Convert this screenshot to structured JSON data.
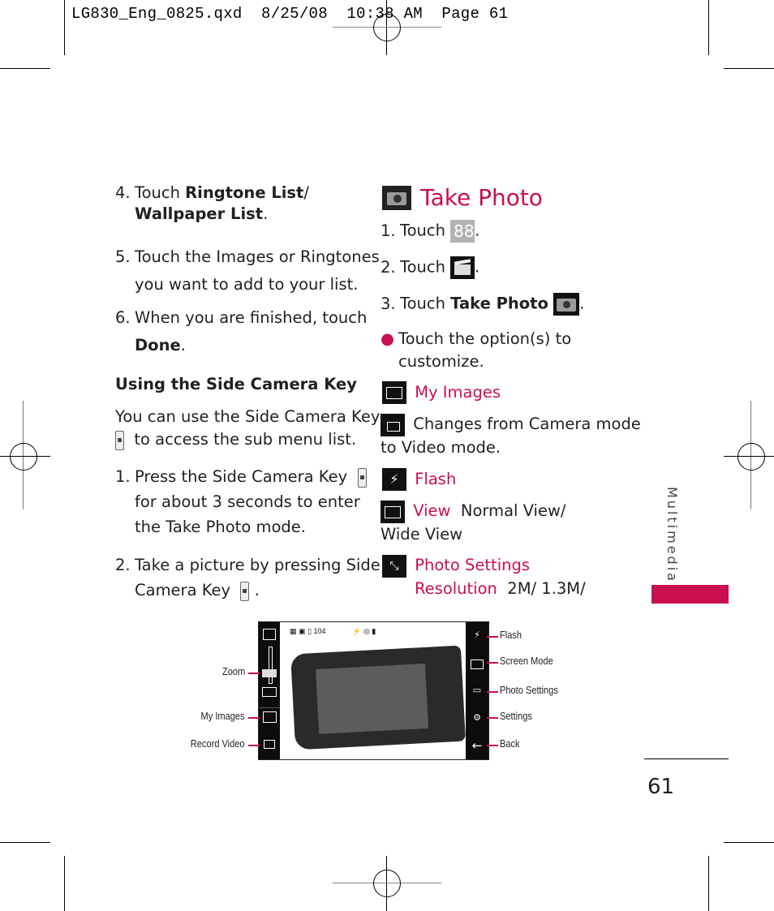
{
  "slug": "LG830_Eng_0825.qxd  8/25/08  10:38 AM  Page 61",
  "left_column": {
    "step4": {
      "num": "4.",
      "pre": "Touch ",
      "bold1": "Ringtone List",
      "mid": "/",
      "bold2": "Wallpaper List",
      "post": "."
    },
    "step5": {
      "num": "5.",
      "line1": "Touch the Images or Ringtones",
      "line2": "you want to add to your list."
    },
    "step6": {
      "num": "6.",
      "line1": "When you are finished, touch",
      "bold": "Done",
      "post": "."
    },
    "subheading": "Using the Side Camera Key",
    "intro_line1": "You can use the Side Camera Key",
    "intro_line2": "to access the sub menu list.",
    "side_step1": {
      "num": "1.",
      "line1": "Press the Side Camera Key",
      "line2": "for about 3 seconds to enter",
      "line3": "the Take Photo mode."
    },
    "side_step2": {
      "num": "2.",
      "line1": "Take a picture by pressing Side",
      "line2": "Camera Key",
      "post": "."
    }
  },
  "right_column": {
    "heading": "Take Photo",
    "step1": {
      "num": "1.",
      "text": "Touch",
      "icon": "grid-icon"
    },
    "step2": {
      "num": "2.",
      "text": "Touch",
      "icon": "clapperboard-icon"
    },
    "step3": {
      "num": "3.",
      "text": "Touch ",
      "bold": "Take Photo",
      "icon": "camera-icon"
    },
    "bullet_line1": "Touch the option(s) to",
    "bullet_line2": "customize.",
    "options": {
      "my_images": "My Images",
      "video_line1": "Changes from Camera mode",
      "video_line2": "to Video mode.",
      "flash": "Flash",
      "view_label": "View",
      "view_desc1": "Normal View/",
      "view_desc2": "Wide View",
      "photo_settings": "Photo Settings",
      "resolution_label": "Resolution",
      "resolution_value": "2M/ 1.3M/"
    }
  },
  "diagram": {
    "status_text": "104",
    "left_labels": [
      "Zoom",
      "My Images",
      "Record Video"
    ],
    "right_labels": [
      "Flash",
      "Screen Mode",
      "Photo Settings",
      "Settings",
      "Back"
    ]
  },
  "side_tab": "Multimedia",
  "page_number": "61",
  "colors": {
    "accent": "#c8104e",
    "text": "#231f20"
  }
}
